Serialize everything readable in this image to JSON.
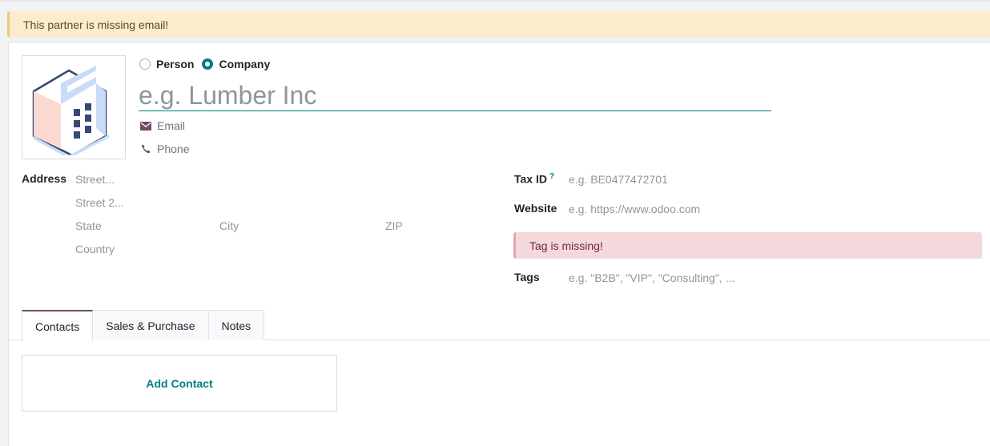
{
  "warning_banner": "This partner is missing email!",
  "type_selector": {
    "options": [
      {
        "label": "Person",
        "selected": false
      },
      {
        "label": "Company",
        "selected": true
      }
    ]
  },
  "name": {
    "placeholder": "e.g. Lumber Inc",
    "value": ""
  },
  "email": {
    "placeholder": "Email",
    "icon": "envelope-icon"
  },
  "phone": {
    "placeholder": "Phone",
    "icon": "phone-icon"
  },
  "address": {
    "label": "Address",
    "street": "Street...",
    "street2": "Street 2...",
    "state": "State",
    "city": "City",
    "zip": "ZIP",
    "country": "Country"
  },
  "tax_id": {
    "label": "Tax ID",
    "help": "?",
    "placeholder": "e.g. BE0477472701"
  },
  "website": {
    "label": "Website",
    "placeholder": "e.g. https://www.odoo.com"
  },
  "tag_alert": "Tag is missing!",
  "tags": {
    "label": "Tags",
    "placeholder": "e.g. \"B2B\", \"VIP\", \"Consulting\", ..."
  },
  "tabs": [
    {
      "label": "Contacts",
      "active": true
    },
    {
      "label": "Sales & Purchase",
      "active": false
    },
    {
      "label": "Notes",
      "active": false
    }
  ],
  "add_contact": "Add Contact",
  "colors": {
    "accent": "#017e84",
    "brand": "#714b67",
    "warning_bg": "#fbecce",
    "danger_bg": "#f5d8dc"
  }
}
